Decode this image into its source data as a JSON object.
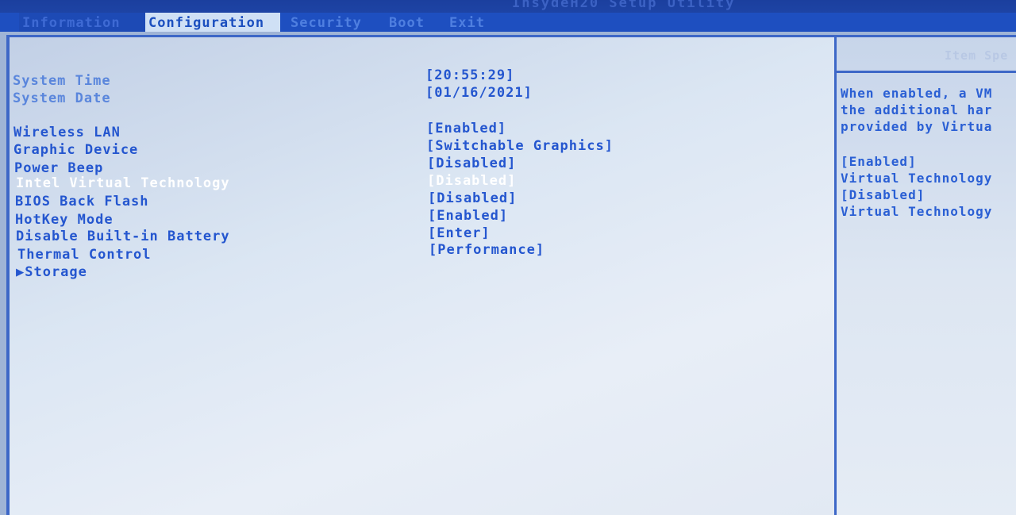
{
  "app_title": "InsydeH20 Setup Utility",
  "menu": {
    "tabs": [
      "Information",
      "Configuration",
      "Security",
      "Boot",
      "Exit"
    ],
    "active": "Configuration"
  },
  "settings": [
    {
      "label": "System Time",
      "value": "[20:55:29]"
    },
    {
      "label": "System Date",
      "value": "[01/16/2021]"
    },
    {
      "label": "Wireless LAN",
      "value": "[Enabled]"
    },
    {
      "label": "Graphic Device",
      "value": "[Switchable Graphics]"
    },
    {
      "label": "Power Beep",
      "value": "[Disabled]"
    },
    {
      "label": "Intel Virtual Technology",
      "value": "[Disabled]",
      "selected": true
    },
    {
      "label": "BIOS Back Flash",
      "value": "[Disabled]"
    },
    {
      "label": "HotKey Mode",
      "value": "[Enabled]"
    },
    {
      "label": "Disable Built-in Battery",
      "value": "[Enter]"
    },
    {
      "label": "Thermal Control",
      "value": "[Performance]"
    },
    {
      "label": "▶Storage",
      "value": ""
    }
  ],
  "help": {
    "header": "Item Spe",
    "description": "When enabled, a VM\nthe additional har\nprovided by Virtua",
    "options": "[Enabled]\nVirtual Technology\n[Disabled]\nVirtual Technology"
  },
  "colors": {
    "menu_bar": "#1e4fc0",
    "panel_background": "#dbe6f3",
    "text": "#2456cf",
    "highlight": "#ffffff"
  }
}
